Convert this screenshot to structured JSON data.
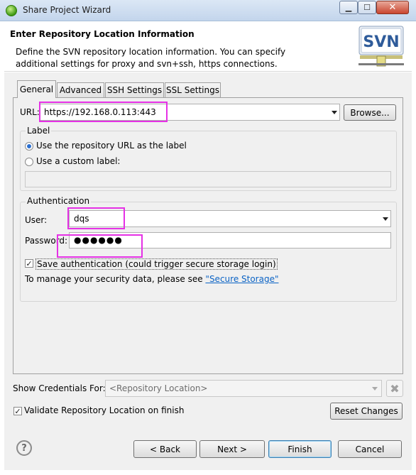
{
  "window": {
    "title": "Share Project Wizard",
    "min": "▁",
    "max": "☐",
    "close": "✕"
  },
  "header": {
    "title": "Enter Repository Location Information",
    "description": "Define the SVN repository location information. You can specify additional settings for proxy and svn+ssh, https connections.",
    "logo_text": "SVN"
  },
  "tabs": [
    "General",
    "Advanced",
    "SSH Settings",
    "SSL Settings"
  ],
  "url": {
    "label": "URL:",
    "value": "https://192.168.0.113:443",
    "browse_label": "Browse..."
  },
  "label_group": {
    "title": "Label",
    "use_url_label": "Use the repository URL as the label",
    "use_custom_label": "Use a custom label:",
    "custom_value": ""
  },
  "auth_group": {
    "title": "Authentication",
    "user_label": "User:",
    "user_value": "dqs",
    "password_label": "Password:",
    "password_value": "●●●●●●",
    "save_auth_label": "Save authentication (could trigger secure storage login)",
    "security_text": "To manage your security data, please see ",
    "security_link": "\"Secure Storage\""
  },
  "credentials": {
    "label": "Show Credentials For:",
    "placeholder": "<Repository Location>"
  },
  "validate": {
    "label": "Validate Repository Location on finish",
    "reset_label": "Reset Changes"
  },
  "footer": {
    "help": "?",
    "back": "< Back",
    "next": "Next >",
    "finish": "Finish",
    "cancel": "Cancel"
  }
}
